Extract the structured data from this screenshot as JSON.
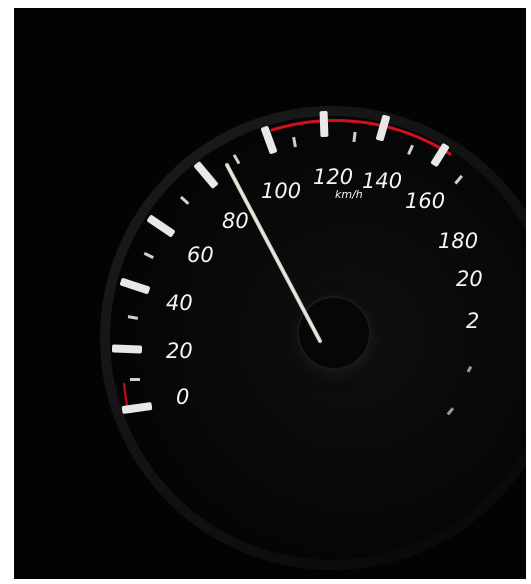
{
  "gauge": {
    "unit": "km/h",
    "scale_labels": [
      "0",
      "20",
      "40",
      "60",
      "80",
      "100",
      "120",
      "140",
      "160",
      "180",
      "20",
      "2"
    ],
    "needle_value_kmh": 82,
    "colors": {
      "background": "#030303",
      "numerals": "#f4f4f4",
      "redline": "#d0101e",
      "needle": "#d8d0c4"
    }
  }
}
